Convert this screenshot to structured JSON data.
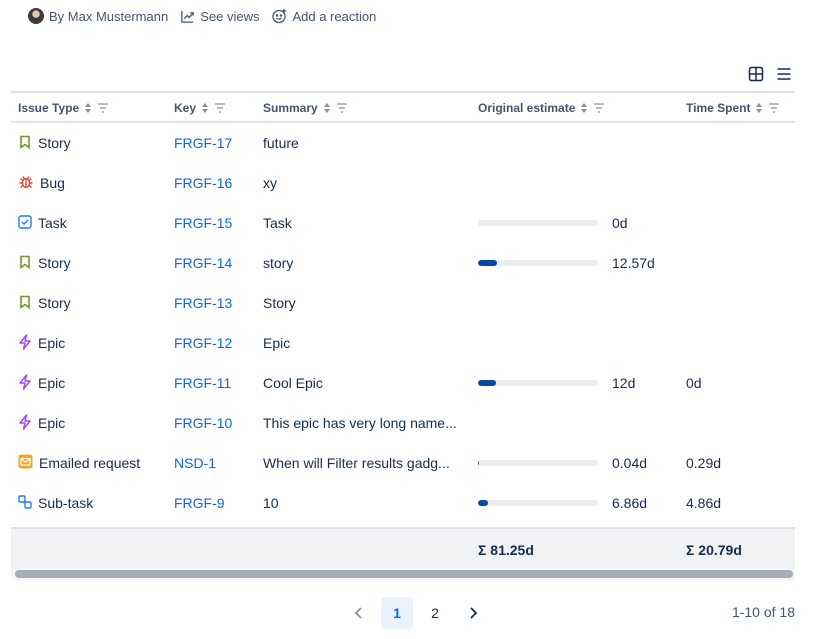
{
  "byline": {
    "author": "By Max Mustermann",
    "views": "See views",
    "reaction": "Add a reaction"
  },
  "columns": [
    "Issue Type",
    "Key",
    "Summary",
    "Original estimate",
    "Time Spent"
  ],
  "rows": [
    {
      "type": "Story",
      "icon": "story-icon",
      "key": "FRGF-17",
      "summary": "future",
      "estimate": "",
      "progress": null,
      "spent": ""
    },
    {
      "type": "Bug",
      "icon": "bug-icon",
      "key": "FRGF-16",
      "summary": "xy",
      "estimate": "",
      "progress": null,
      "spent": ""
    },
    {
      "type": "Task",
      "icon": "task-icon",
      "key": "FRGF-15",
      "summary": "Task",
      "estimate": "0d",
      "progress": 0,
      "spent": ""
    },
    {
      "type": "Story",
      "icon": "story-icon",
      "key": "FRGF-14",
      "summary": "story",
      "estimate": "12.57d",
      "progress": 0.16,
      "spent": ""
    },
    {
      "type": "Story",
      "icon": "story-icon",
      "key": "FRGF-13",
      "summary": "Story",
      "estimate": "",
      "progress": null,
      "spent": ""
    },
    {
      "type": "Epic",
      "icon": "epic-icon",
      "key": "FRGF-12",
      "summary": "Epic",
      "estimate": "",
      "progress": null,
      "spent": ""
    },
    {
      "type": "Epic",
      "icon": "epic-icon",
      "key": "FRGF-11",
      "summary": "Cool Epic",
      "estimate": "12d",
      "progress": 0.15,
      "spent": "0d"
    },
    {
      "type": "Epic",
      "icon": "epic-icon",
      "key": "FRGF-10",
      "summary": "This epic has very long name...",
      "estimate": "",
      "progress": null,
      "spent": ""
    },
    {
      "type": "Emailed request",
      "icon": "email-request-icon",
      "key": "NSD-1",
      "summary": "When will Filter results gadg...",
      "estimate": "0.04d",
      "progress": 0.01,
      "spent": "0.29d"
    },
    {
      "type": "Sub-task",
      "icon": "subtask-icon",
      "key": "FRGF-9",
      "summary": "10",
      "estimate": "6.86d",
      "progress": 0.08,
      "spent": "4.86d"
    }
  ],
  "totals": {
    "estimate": "Σ 81.25d",
    "spent": "Σ 20.79d"
  },
  "pagination": {
    "pages": [
      "1",
      "2"
    ],
    "current": "1",
    "count": "1-10 of 18"
  },
  "colors": {
    "link": "#0c66e4",
    "bar_fill": "#0747a6",
    "bar_track": "#ebecf0",
    "story": "#6a9a23",
    "bug": "#e2483d",
    "task": "#1d7afc",
    "epic": "#a54cd8",
    "email": "#f5a623",
    "subtask": "#1d7afc"
  }
}
